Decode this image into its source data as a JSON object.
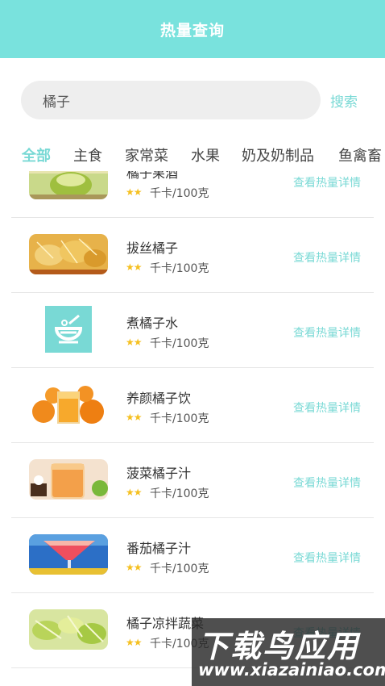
{
  "header": {
    "title": "热量查询"
  },
  "search": {
    "value": "橘子",
    "button_label": "搜索"
  },
  "tabs": [
    "全部",
    "主食",
    "家常菜",
    "水果",
    "奶及奶制品",
    "鱼禽畜"
  ],
  "list": {
    "detail_label": "查看热量详情",
    "unit_label": "千卡/100克",
    "stars": "★★",
    "items": [
      {
        "name": "橘子果酒",
        "rating": 2,
        "thumb_icon": "juice-glass-photo"
      },
      {
        "name": "拔丝橘子",
        "rating": 2,
        "thumb_icon": "fried-dessert-photo"
      },
      {
        "name": "煮橘子水",
        "rating": 2,
        "thumb_icon": "bowl-placeholder-icon"
      },
      {
        "name": "养颜橘子饮",
        "rating": 2,
        "thumb_icon": "orange-juice-photo"
      },
      {
        "name": "菠菜橘子汁",
        "rating": 2,
        "thumb_icon": "juice-cup-photo"
      },
      {
        "name": "番茄橘子汁",
        "rating": 2,
        "thumb_icon": "cocktail-photo"
      },
      {
        "name": "橘子凉拌蔬菜",
        "rating": 2,
        "thumb_icon": "cabbage-salad-photo"
      }
    ]
  },
  "watermark": {
    "title": "下载鸟应用",
    "url": "www.xiazainiao.com"
  },
  "colors": {
    "accent": "#79e2dd",
    "accent_text": "#79d9d5",
    "star": "#f5c021"
  }
}
